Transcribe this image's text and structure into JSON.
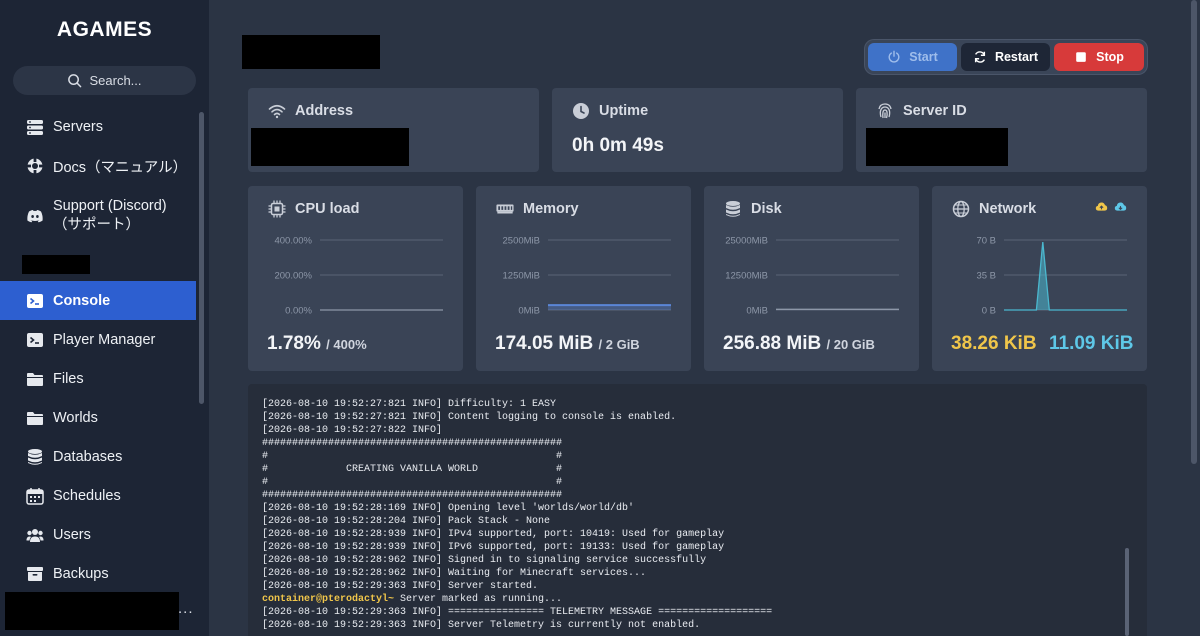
{
  "app": {
    "brand": "AGAMES"
  },
  "sidebar": {
    "search_label": "Search...",
    "items": [
      {
        "label": "Servers",
        "icon": "server-icon"
      },
      {
        "label": "Docs（マニュアル）",
        "icon": "lifebuoy-icon"
      },
      {
        "label_line1": "Support (Discord)",
        "label_line2": "（サポート）",
        "icon": "discord-icon"
      },
      {
        "label": "Console",
        "icon": "terminal-icon",
        "active": true
      },
      {
        "label": "Player Manager",
        "icon": "terminal-icon"
      },
      {
        "label": "Files",
        "icon": "folder-icon"
      },
      {
        "label": "Worlds",
        "icon": "folder-icon"
      },
      {
        "label": "Databases",
        "icon": "database-icon"
      },
      {
        "label": "Schedules",
        "icon": "calendar-icon"
      },
      {
        "label": "Users",
        "icon": "users-icon"
      },
      {
        "label": "Backups",
        "icon": "archive-icon"
      }
    ],
    "more_label": "..."
  },
  "power": {
    "start": "Start",
    "restart": "Restart",
    "stop": "Stop"
  },
  "cards": {
    "address": {
      "title": "Address"
    },
    "uptime": {
      "title": "Uptime",
      "value": "0h 0m 49s"
    },
    "server_id": {
      "title": "Server ID"
    }
  },
  "metrics": {
    "cpu": {
      "title": "CPU load",
      "value": "1.78%",
      "limit": "/ 400%",
      "ticks": [
        "400.00%",
        "200.00%",
        "0.00%"
      ]
    },
    "memory": {
      "title": "Memory",
      "value": "174.05 MiB",
      "limit": "/ 2 GiB",
      "ticks": [
        "2500MiB",
        "1250MiB",
        "0MiB"
      ]
    },
    "disk": {
      "title": "Disk",
      "value": "256.88 MiB",
      "limit": "/ 20 GiB",
      "ticks": [
        "25000MiB",
        "12500MiB",
        "0MiB"
      ]
    },
    "network": {
      "title": "Network",
      "up": "38.26 KiB",
      "down": "11.09 KiB",
      "ticks": [
        "70 B",
        "35 B",
        "0 B"
      ]
    }
  },
  "chart_data": [
    {
      "type": "line",
      "title": "CPU load",
      "ylim": [
        0,
        400
      ],
      "x": [
        0,
        1,
        2,
        3,
        4,
        5,
        6,
        7,
        8,
        9,
        10,
        11,
        12,
        13,
        14,
        15,
        16,
        17,
        18,
        19
      ],
      "series": [
        {
          "values": [
            0,
            0,
            0,
            0,
            0,
            0,
            0,
            0,
            0,
            0,
            0,
            0,
            0,
            0,
            0,
            0,
            0,
            0,
            0,
            0
          ]
        }
      ]
    },
    {
      "type": "area",
      "title": "Memory",
      "ylim": [
        0,
        2500
      ],
      "x": [
        0,
        1,
        2,
        3,
        4,
        5,
        6,
        7,
        8,
        9,
        10,
        11,
        12,
        13,
        14,
        15,
        16,
        17,
        18,
        19
      ],
      "series": [
        {
          "values": [
            174,
            174,
            174,
            174,
            174,
            174,
            174,
            174,
            174,
            174,
            174,
            174,
            174,
            174,
            174,
            174,
            174,
            174,
            174,
            174
          ]
        }
      ]
    },
    {
      "type": "line",
      "title": "Disk",
      "ylim": [
        0,
        25000
      ],
      "x": [
        0,
        1,
        2,
        3,
        4,
        5,
        6,
        7,
        8,
        9,
        10,
        11,
        12,
        13,
        14,
        15,
        16,
        17,
        18,
        19
      ],
      "series": [
        {
          "values": [
            257,
            257,
            257,
            257,
            257,
            257,
            257,
            257,
            257,
            257,
            257,
            257,
            257,
            257,
            257,
            257,
            257,
            257,
            257,
            257
          ]
        }
      ]
    },
    {
      "type": "area",
      "title": "Network",
      "ylim": [
        0,
        70
      ],
      "x": [
        0,
        1,
        2,
        3,
        4,
        5,
        6,
        7,
        8,
        9,
        10,
        11,
        12,
        13,
        14,
        15,
        16,
        17,
        18,
        19
      ],
      "series": [
        {
          "values": [
            0,
            0,
            0,
            0,
            0,
            0,
            68,
            0,
            0,
            0,
            0,
            0,
            0,
            0,
            0,
            0,
            0,
            0,
            0,
            0
          ]
        }
      ]
    }
  ],
  "colors": {
    "accent": "#2d5fd0",
    "stop": "#d73a3a",
    "upload": "#f0c64a",
    "download": "#5ec8e8",
    "memory_line": "#5b86d6",
    "network_area": "#4bb8cf"
  },
  "console": {
    "lines": [
      "[2026-08-10 19:52:27:821 INFO] Difficulty: 1 EASY",
      "[2026-08-10 19:52:27:821 INFO] Content logging to console is enabled.",
      "[2026-08-10 19:52:27:822 INFO]",
      "##################################################",
      "#                                                #",
      "#             CREATING VANILLA WORLD             #",
      "#                                                #",
      "##################################################",
      "[2026-08-10 19:52:28:169 INFO] Opening level 'worlds/world/db'",
      "[2026-08-10 19:52:28:204 INFO] Pack Stack - None",
      "[2026-08-10 19:52:28:939 INFO] IPv4 supported, port: 10419: Used for gameplay",
      "[2026-08-10 19:52:28:939 INFO] IPv6 supported, port: 19133: Used for gameplay",
      "[2026-08-10 19:52:28:962 INFO] Signed in to signaling service successfully",
      "[2026-08-10 19:52:28:962 INFO] Waiting for Minecraft services...",
      "[2026-08-10 19:52:29:363 INFO] Server started."
    ],
    "prompt": "container@pterodactyl~",
    "prompt_text": " Server marked as running...",
    "lines_after": [
      "[2026-08-10 19:52:29:363 INFO] ================ TELEMETRY MESSAGE ===================",
      "[2026-08-10 19:52:29:363 INFO] Server Telemetry is currently not enabled."
    ]
  }
}
